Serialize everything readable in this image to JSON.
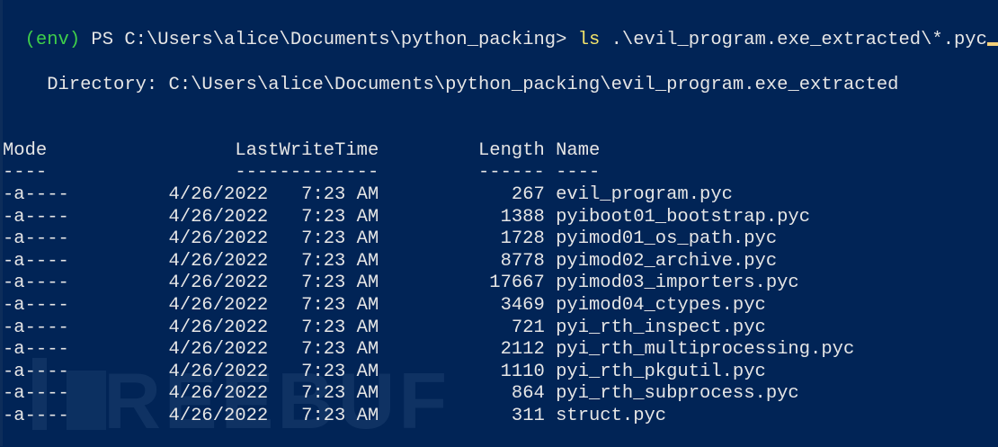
{
  "prompt": {
    "env": "(env)",
    "ps_path": " PS C:\\Users\\alice\\Documents\\python_packing> ",
    "command": "ls",
    "args": " .\\evil_program.exe_extracted\\*.pyc"
  },
  "directory_line": "    Directory: C:\\Users\\alice\\Documents\\python_packing\\evil_program.exe_extracted",
  "headers": {
    "mode": "Mode",
    "time": "LastWriteTime",
    "length": "Length",
    "name": "Name"
  },
  "underlines": {
    "mode": "----",
    "time": "-------------",
    "length": "------",
    "name": "----"
  },
  "rows": [
    {
      "mode": "-a----",
      "date": "4/26/2022",
      "time": "7:23 AM",
      "length": "267",
      "name": "evil_program.pyc"
    },
    {
      "mode": "-a----",
      "date": "4/26/2022",
      "time": "7:23 AM",
      "length": "1388",
      "name": "pyiboot01_bootstrap.pyc"
    },
    {
      "mode": "-a----",
      "date": "4/26/2022",
      "time": "7:23 AM",
      "length": "1728",
      "name": "pyimod01_os_path.pyc"
    },
    {
      "mode": "-a----",
      "date": "4/26/2022",
      "time": "7:23 AM",
      "length": "8778",
      "name": "pyimod02_archive.pyc"
    },
    {
      "mode": "-a----",
      "date": "4/26/2022",
      "time": "7:23 AM",
      "length": "17667",
      "name": "pyimod03_importers.pyc"
    },
    {
      "mode": "-a----",
      "date": "4/26/2022",
      "time": "7:23 AM",
      "length": "3469",
      "name": "pyimod04_ctypes.pyc"
    },
    {
      "mode": "-a----",
      "date": "4/26/2022",
      "time": "7:23 AM",
      "length": "721",
      "name": "pyi_rth_inspect.pyc"
    },
    {
      "mode": "-a----",
      "date": "4/26/2022",
      "time": "7:23 AM",
      "length": "2112",
      "name": "pyi_rth_multiprocessing.pyc"
    },
    {
      "mode": "-a----",
      "date": "4/26/2022",
      "time": "7:23 AM",
      "length": "1110",
      "name": "pyi_rth_pkgutil.pyc"
    },
    {
      "mode": "-a----",
      "date": "4/26/2022",
      "time": "7:23 AM",
      "length": "864",
      "name": "pyi_rth_subprocess.pyc"
    },
    {
      "mode": "-a----",
      "date": "4/26/2022",
      "time": "7:23 AM",
      "length": "311",
      "name": "struct.pyc"
    }
  ],
  "watermark": "FREEBUF",
  "colors": {
    "background": "#012456",
    "text": "#e6e6e6",
    "env": "#3fcf4a",
    "command": "#f2e36a"
  }
}
